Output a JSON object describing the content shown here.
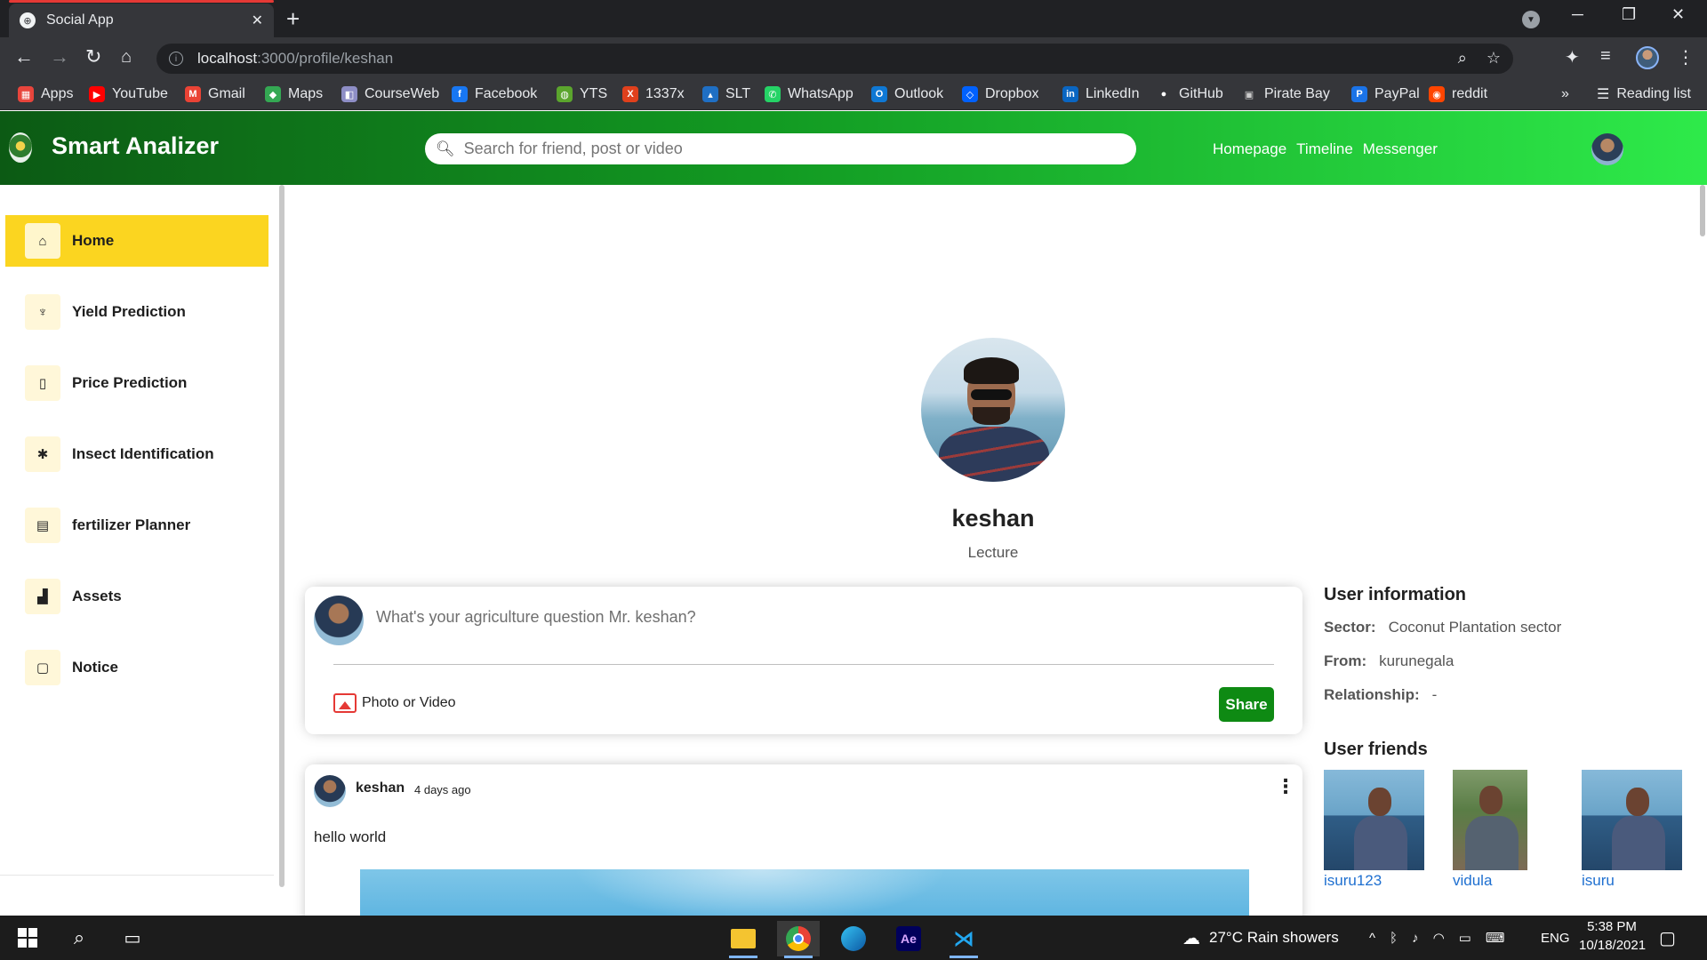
{
  "browser": {
    "tab_title": "Social App",
    "url_host": "localhost",
    "url_path": ":3000/profile/keshan",
    "bookmarks": [
      {
        "label": "Apps",
        "icon": "apps-grid-icon",
        "color": "#e8453c"
      },
      {
        "label": "YouTube",
        "icon": "youtube-icon",
        "color": "#ff0000"
      },
      {
        "label": "Gmail",
        "icon": "gmail-icon",
        "color": "#ea4335"
      },
      {
        "label": "Maps",
        "icon": "maps-icon",
        "color": "#34a853"
      },
      {
        "label": "CourseWeb",
        "icon": "courseweb-icon",
        "color": "#8e8ec6"
      },
      {
        "label": "Facebook",
        "icon": "facebook-icon",
        "color": "#1877f2"
      },
      {
        "label": "YTS",
        "icon": "yts-icon",
        "color": "#5ba52d"
      },
      {
        "label": "1337x",
        "icon": "1337x-icon",
        "color": "#e0401c"
      },
      {
        "label": "SLT",
        "icon": "slt-icon",
        "color": "#1f6fc4"
      },
      {
        "label": "WhatsApp",
        "icon": "whatsapp-icon",
        "color": "#25d366"
      },
      {
        "label": "Outlook",
        "icon": "outlook-icon",
        "color": "#0f78d4"
      },
      {
        "label": "Dropbox",
        "icon": "dropbox-icon",
        "color": "#0061fe"
      },
      {
        "label": "LinkedIn",
        "icon": "linkedin-icon",
        "color": "#0a66c2"
      },
      {
        "label": "GitHub",
        "icon": "github-icon",
        "color": "#ffffff"
      },
      {
        "label": "Pirate Bay",
        "icon": "piratebay-icon",
        "color": "#cccccc"
      },
      {
        "label": "PayPal",
        "icon": "paypal-icon",
        "color": "#1a73e8"
      },
      {
        "label": "reddit",
        "icon": "reddit-icon",
        "color": "#ff4500"
      }
    ],
    "overflow": "»",
    "reading_list": "Reading list"
  },
  "app": {
    "brand": "Smart Analizer",
    "search_placeholder": "Search for friend, post or video",
    "nav_links": [
      "Homepage",
      "Timeline",
      "Messenger"
    ],
    "accent_color": "#13a022",
    "active_color": "#fbd520"
  },
  "sidebar": {
    "items": [
      {
        "label": "Home",
        "icon": "home-icon",
        "active": true
      },
      {
        "label": "Yield Prediction",
        "icon": "plant-icon",
        "active": false
      },
      {
        "label": "Price Prediction",
        "icon": "book-icon",
        "active": false
      },
      {
        "label": "Insect Identification",
        "icon": "insect-icon",
        "active": false
      },
      {
        "label": "fertilizer Planner",
        "icon": "document-icon",
        "active": false
      },
      {
        "label": "Assets",
        "icon": "assets-icon",
        "active": false
      },
      {
        "label": "Notice",
        "icon": "file-icon",
        "active": false
      }
    ]
  },
  "profile": {
    "name": "keshan",
    "description": "Lecture"
  },
  "share": {
    "placeholder": "What's your agriculture question Mr. keshan?",
    "photo_label": "Photo or Video",
    "button": "Share"
  },
  "post": {
    "username": "keshan",
    "date": "4 days ago",
    "text": "hello world"
  },
  "user_info": {
    "title": "User information",
    "fields": [
      {
        "key": "Sector:",
        "value": "Coconut Plantation sector"
      },
      {
        "key": "From:",
        "value": "kurunegala"
      },
      {
        "key": "Relationship:",
        "value": "-"
      }
    ]
  },
  "friends": {
    "title": "User friends",
    "list": [
      "isuru123",
      "vidula",
      "isuru"
    ]
  },
  "taskbar": {
    "weather": "27°C  Rain showers",
    "lang": "ENG",
    "time": "5:38 PM",
    "date": "10/18/2021"
  }
}
